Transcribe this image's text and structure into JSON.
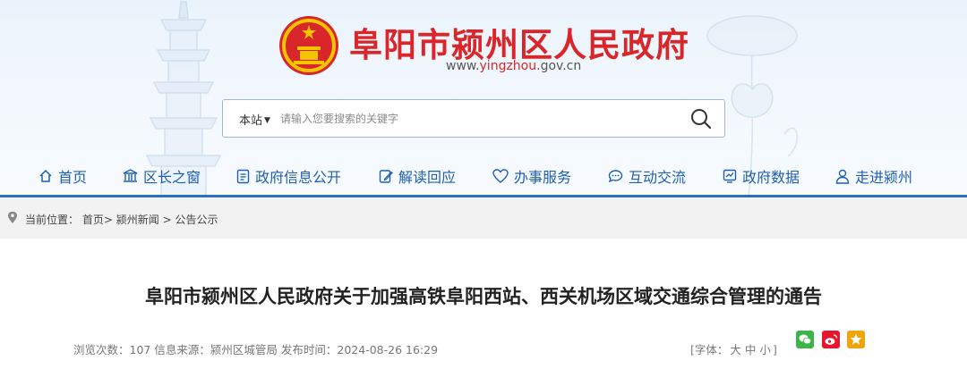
{
  "site": {
    "title": "阜阳市颍州区人民政府",
    "url_prefix": "www.",
    "url_highlight": "yingzhou",
    "url_suffix": ".gov.cn"
  },
  "search": {
    "scope_label": "本站",
    "placeholder": "请输入您要搜索的关键字",
    "value": ""
  },
  "nav": {
    "items": [
      {
        "label": "首页",
        "icon": "home-icon"
      },
      {
        "label": "区长之窗",
        "icon": "building-icon"
      },
      {
        "label": "政府信息公开",
        "icon": "document-icon"
      },
      {
        "label": "解读回应",
        "icon": "edit-icon"
      },
      {
        "label": "办事服务",
        "icon": "heart-hand-icon"
      },
      {
        "label": "互动交流",
        "icon": "chat-icon"
      },
      {
        "label": "政府数据",
        "icon": "data-chart-icon"
      },
      {
        "label": "走进颍州",
        "icon": "person-icon"
      }
    ]
  },
  "breadcrumb": {
    "prefix": "当前位置：",
    "items": [
      "首页",
      "颍州新闻",
      "公告公示"
    ],
    "separator": ">"
  },
  "article": {
    "title": "阜阳市颍州区人民政府关于加强高铁阜阳西站、西关机场区域交通综合管理的通告",
    "views_label": "浏览次数：",
    "views": "107",
    "source_label": "信息来源：",
    "source": "颍州区城管局",
    "date_label": "发布时间：",
    "date": "2024-08-26 16:29"
  },
  "font_size": {
    "open": "[字体：",
    "large": "大",
    "medium": "中",
    "small": "小",
    "close": "]"
  },
  "share": [
    "wechat-icon",
    "weibo-icon",
    "star-icon"
  ],
  "colors": {
    "title_red": "#d8262a",
    "nav_blue": "#1f5fae",
    "nav_line": "#2b6fc2",
    "breadcrumb_bg": "#f2f2f2"
  }
}
